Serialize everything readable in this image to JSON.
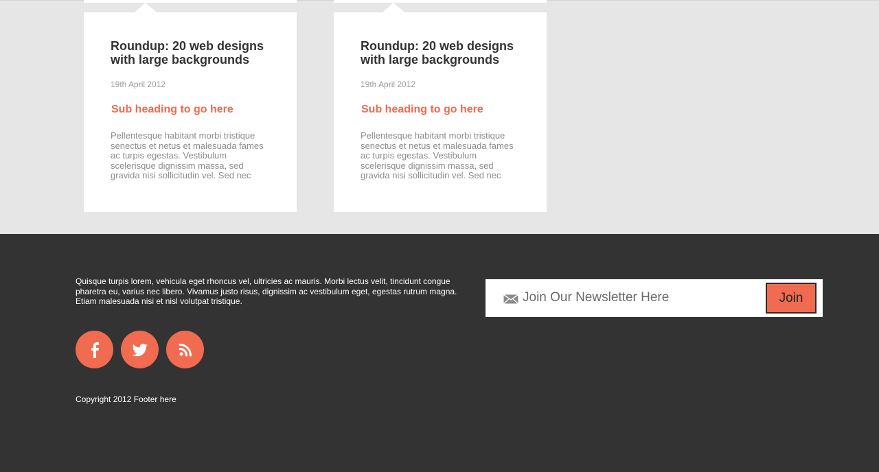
{
  "posts": [
    {
      "title": "Roundup: 20 web designs with large backgrounds",
      "date": "19th April 2012",
      "subheading": "Sub heading to go here",
      "body": "Pellentesque habitant morbi tristique senectus et netus et malesuada fames ac turpis egestas. Vestibulum scelerisque dignissim massa, sed gravida nisi sollicitudin vel. Sed nec"
    },
    {
      "title": "Roundup: 20 web designs with large backgrounds",
      "date": "19th April 2012",
      "subheading": "Sub heading to go here",
      "body": "Pellentesque habitant morbi tristique senectus et netus et malesuada fames ac turpis egestas. Vestibulum scelerisque dignissim massa, sed gravida nisi sollicitudin vel. Sed nec"
    }
  ],
  "footer": {
    "text": "Quisque turpis lorem, vehicula eget rhoncus vel, ultricies ac mauris. Morbi lectus velit, tincidunt congue pharetra eu, varius nec libero. Vivamus justo risus, dignissim ac vestibulum eget, egestas rutrum magna. Etiam malesuada nisi et nisl volutpat tristique.",
    "copyright": "Copyright 2012 Footer here",
    "social": [
      {
        "icon": "facebook-icon"
      },
      {
        "icon": "twitter-icon"
      },
      {
        "icon": "rss-icon"
      }
    ]
  },
  "newsletter": {
    "placeholder": "Join Our Newsletter Here",
    "button_label": "Join",
    "icon": "envelope-icon"
  },
  "colors": {
    "accent": "#f06b4f",
    "footer_bg": "#333333",
    "content_bg": "#e6e6e6",
    "card_bg": "#ffffff"
  }
}
